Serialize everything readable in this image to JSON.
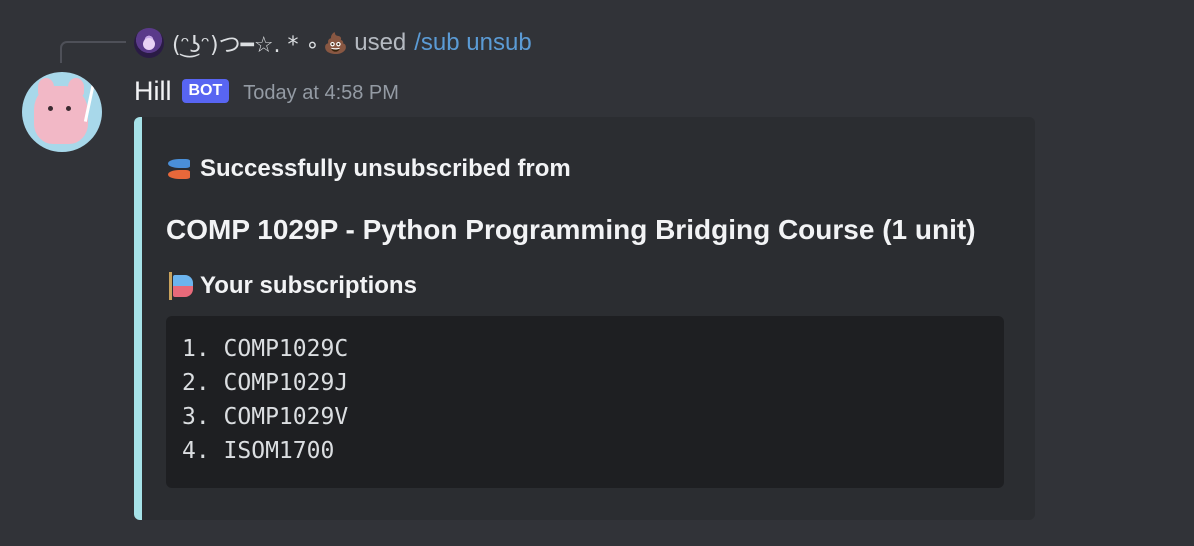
{
  "interaction": {
    "user_name": "(ᵔ͜ʖᵔ)つ━☆. * ∘",
    "poop_emoji": "💩",
    "used_label": "used",
    "command": "/sub unsub"
  },
  "message": {
    "author": "Hill",
    "bot_tag": "BOT",
    "timestamp": "Today at 4:58 PM"
  },
  "embed": {
    "accent_color": "#a6e2e8",
    "author_icon": "koinobori-fish-icon",
    "author_text": "Successfully unsubscribed from",
    "title": "COMP 1029P - Python Programming Bridging Course (1 unit)",
    "field_icon": "carp-streamer-flag-icon",
    "field_name": "Your subscriptions",
    "subscriptions": [
      "1. COMP1029C",
      "2. COMP1029J",
      "3. COMP1029V",
      "4. ISOM1700"
    ]
  }
}
